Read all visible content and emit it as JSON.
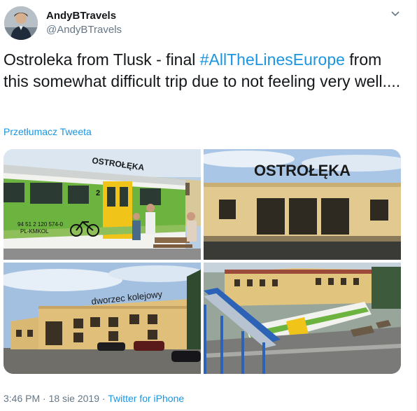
{
  "author": {
    "display_name": "AndyBTravels",
    "handle": "@AndyBTravels"
  },
  "tweet": {
    "text_before": "Ostroleka from Tlusk - final ",
    "hashtag": "#AllTheLinesEurope",
    "text_after": " from this somewhat difficult trip due to not feeling very well....",
    "translate_link": "Przetłumacz Tweeta"
  },
  "media": {
    "photo1": {
      "station_sign": "OSTROŁĘKA",
      "train_number": "94 51 2 120 574-0",
      "train_operator": "PL-KMKOL",
      "side_number": "2"
    },
    "photo2": {
      "station_sign": "OSTROŁĘKA"
    },
    "photo3": {
      "station_sign": "dworzec kolejowy"
    },
    "photo4": {}
  },
  "meta": {
    "time": "3:46 PM",
    "separator1": " · ",
    "date": "18 sie 2019",
    "separator2": " · ",
    "source": "Twitter for iPhone"
  },
  "colors": {
    "link": "#1b95e0",
    "secondary_text": "#657786",
    "primary_text": "#14171a"
  },
  "icons": {
    "caret": "chevron-down-icon"
  }
}
